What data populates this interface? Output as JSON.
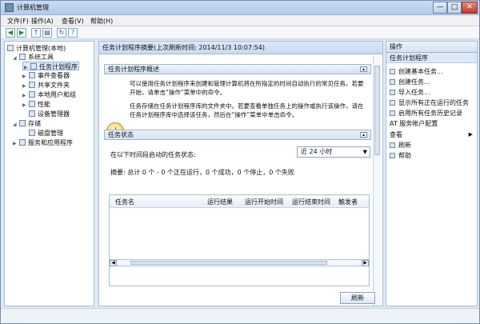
{
  "window": {
    "title": "计算机管理",
    "controls": {
      "min": "—",
      "max": "□",
      "close": "✕"
    }
  },
  "menu": {
    "items": [
      "文件(F)",
      "操作(A)",
      "查看(V)",
      "帮助(H)"
    ]
  },
  "toolbar": {
    "icons": [
      "back-icon",
      "forward-icon",
      "up-icon",
      "show-hide-console-tree-icon",
      "refresh-icon",
      "help-icon"
    ]
  },
  "tree": {
    "root": "计算机管理(本地)",
    "system_tools": "系统工具",
    "task_scheduler": "任务计划程序",
    "event_viewer": "事件查看器",
    "shared_folders": "共享文件夹",
    "local_users_groups": "本地用户和组",
    "performance": "性能",
    "device_manager": "设备管理器",
    "storage": "存储",
    "disk_management": "磁盘管理",
    "services_apps": "服务和应用程序"
  },
  "center": {
    "breadcrumb": "任务计划程序摘要(上次刷新时间: 2014/11/3 10:07:54)",
    "overview_title": "任务计划程序概述",
    "overview_line1": "可以使用任务计划程序来创建和管理计算机将在所指定的时间自动执行的常见任务。若要",
    "overview_line2": "开始，请单击“操作”菜单中的命令。",
    "overview_line3": "任务存储在任务计划程序库的文件夹中。若要查看单独任务上的操作或执行该操作，请在",
    "overview_line4": "任务计划程序库中选择该任务，然后在“操作”菜单中单击命令。",
    "status_title": "任务状态",
    "status_prompt": "在以下时间段启动的任务状态:",
    "status_summary": "摘要: 总计 0 个 - 0 个正在运行，0 个成功，0 个停止，0 个失败",
    "period": "近 24 小时",
    "refresh": "刷新",
    "table_headers": [
      "任务名",
      "运行结果",
      "运行开始时间",
      "运行结束时间",
      "触发者"
    ]
  },
  "actions": {
    "title": "操作",
    "subtitle": "任务计划程序",
    "items": [
      "创建基本任务...",
      "创建任务...",
      "导入任务...",
      "显示所有正在运行的任务",
      "启用所有任务历史记录",
      "AT 服务帐户配置",
      "查看",
      "刷新",
      "帮助"
    ]
  }
}
